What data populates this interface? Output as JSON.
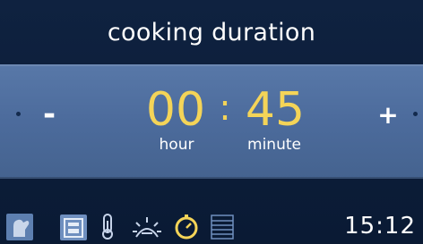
{
  "title": "cooking duration",
  "duration": {
    "hours": "00",
    "separator": ":",
    "minutes": "45",
    "hour_unit": "hour",
    "minute_unit": "minute"
  },
  "controls": {
    "decrease_label": "-",
    "increase_label": "+"
  },
  "status_bar": {
    "icons": [
      "glove-icon",
      "oven-mode-icon",
      "thermometer-icon",
      "heating-element-icon",
      "timer-icon",
      "menu-lines-icon"
    ],
    "active_icon": "timer-icon",
    "clock": "15:12"
  },
  "colors": {
    "value": "#f4d458",
    "band": "#4c6b9c",
    "background": "#0a1a34",
    "text": "#ffffff"
  }
}
